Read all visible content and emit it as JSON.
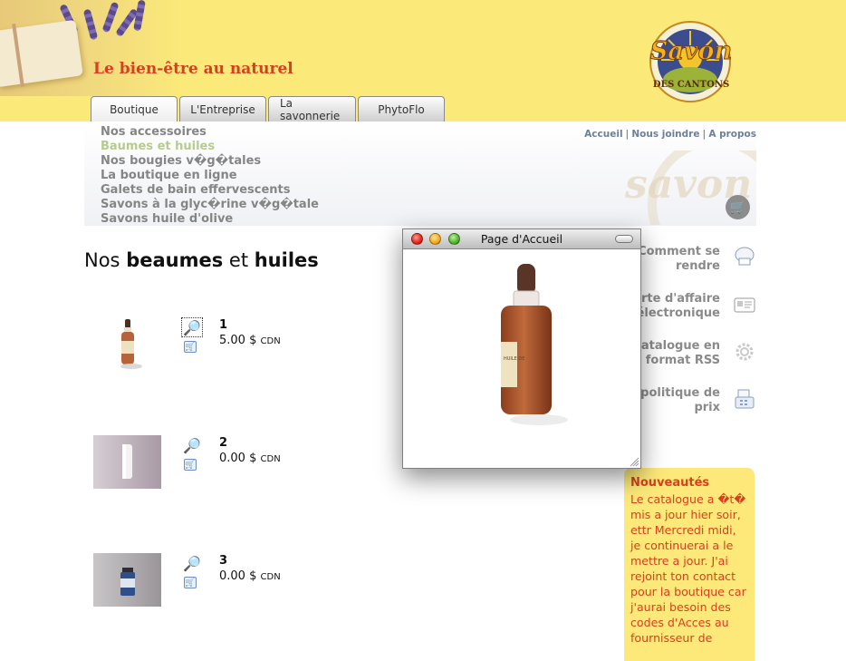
{
  "header": {
    "tagline": "Le bien-être au naturel",
    "logo": {
      "top": "Savon",
      "bottom": "DES CANTONS"
    }
  },
  "tabs": [
    {
      "label": "Boutique",
      "active": true
    },
    {
      "label": "L'Entreprise",
      "active": false
    },
    {
      "label": "La savonnerie",
      "active": false
    },
    {
      "label": "PhytoFlo",
      "active": false
    }
  ],
  "subnav": [
    {
      "label": "Nos accessoires",
      "active": false
    },
    {
      "label": "Baumes et huiles",
      "active": true
    },
    {
      "label": "Nos bougies v�g�tales",
      "active": false
    },
    {
      "label": "La boutique en ligne",
      "active": false
    },
    {
      "label": "Galets de bain effervescents",
      "active": false
    },
    {
      "label": "Savons à la glyc�rine v�g�tale",
      "active": false
    },
    {
      "label": "Savons huile d'olive",
      "active": false
    }
  ],
  "top_links": {
    "home": "Accueil",
    "contact": "Nous joindre",
    "about": "A propos",
    "separator": "|"
  },
  "watermark": {
    "text": "savon"
  },
  "page_title": {
    "prefix": "Nos ",
    "bold1": "beaumes",
    "middle": " et ",
    "bold2": "huiles"
  },
  "products": [
    {
      "name": "1",
      "price": "5.00",
      "currency_symbol": "$",
      "currency": "CDN",
      "thumb": "amber-dropper-bottle",
      "zoom_focused": true
    },
    {
      "name": "2",
      "price": "0.00",
      "currency_symbol": "$",
      "currency": "CDN",
      "thumb": "white-tube",
      "zoom_focused": false
    },
    {
      "name": "3",
      "price": "0.00",
      "currency_symbol": "$",
      "currency": "CDN",
      "thumb": "blue-vial",
      "zoom_focused": false
    }
  ],
  "right_links": [
    {
      "line1": "Comment se",
      "line2": "rendre",
      "icon": "chef-hat-icon"
    },
    {
      "line1": "arte d'affaire",
      "line2": "électronique",
      "icon": "business-card-icon"
    },
    {
      "line1": "catalogue en",
      "line2": "format RSS",
      "icon": "gear-icon"
    },
    {
      "line1": "e politique de",
      "line2": "prix",
      "icon": "cash-register-icon"
    }
  ],
  "news": {
    "title": "Nouveautés",
    "body": "Le catalogue a �t� mis a jour hier soir, ettr Mercredi midi, je continuerai a le mettre a jour. J'ai rejoint ton contact pour la boutique car j'aurai besoin des codes d'Acces au fournisseur de"
  },
  "popup": {
    "title": "Page d'Accueil",
    "image_label": "HUILE DE"
  },
  "colors": {
    "header_yellow": "#fbe97a",
    "tagline_red": "#d7401f",
    "subnav_gray": "#858585",
    "subnav_active": "#b6cc8e",
    "link_blue": "#6f7f9a",
    "news_bg": "#fde979"
  }
}
